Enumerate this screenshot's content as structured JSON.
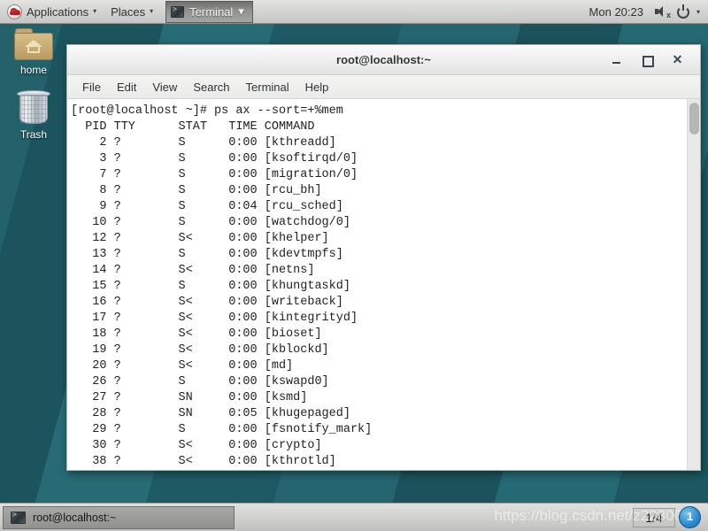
{
  "top_panel": {
    "menus": [
      {
        "label": "Applications",
        "icon": "redhat-logo",
        "caret": "▾"
      },
      {
        "label": "Places",
        "caret": "▾"
      }
    ],
    "window_button": {
      "label": "Terminal",
      "icon": "terminal-icon",
      "caret": "▾"
    },
    "clock": "Mon 20:23",
    "icons": [
      "speaker-muted-icon",
      "power-icon"
    ],
    "caret": "▾",
    "mute_mark": "x"
  },
  "desktop": {
    "icons": [
      {
        "label": "home",
        "icon": "folder-home-icon"
      },
      {
        "label": "Trash",
        "icon": "trash-icon"
      }
    ],
    "background_color": "#1f5c66"
  },
  "terminal": {
    "title": "root@localhost:~",
    "window_buttons": {
      "minimize": "–",
      "maximize": "□",
      "close": "✕"
    },
    "menubar": [
      "File",
      "Edit",
      "View",
      "Search",
      "Terminal",
      "Help"
    ],
    "prompt": "[root@localhost ~]#",
    "command": "ps ax --sort=+%mem",
    "columns": [
      "PID",
      "TTY",
      "STAT",
      "TIME",
      "COMMAND"
    ],
    "content": "[root@localhost ~]# ps ax --sort=+%mem\n  PID TTY      STAT   TIME COMMAND\n    2 ?        S      0:00 [kthreadd]\n    3 ?        S      0:00 [ksoftirqd/0]\n    7 ?        S      0:00 [migration/0]\n    8 ?        S      0:00 [rcu_bh]\n    9 ?        S      0:04 [rcu_sched]\n   10 ?        S      0:00 [watchdog/0]\n   12 ?        S<     0:00 [khelper]\n   13 ?        S      0:00 [kdevtmpfs]\n   14 ?        S<     0:00 [netns]\n   15 ?        S      0:00 [khungtaskd]\n   16 ?        S<     0:00 [writeback]\n   17 ?        S<     0:00 [kintegrityd]\n   18 ?        S<     0:00 [bioset]\n   19 ?        S<     0:00 [kblockd]\n   20 ?        S<     0:00 [md]\n   26 ?        S      0:00 [kswapd0]\n   27 ?        SN     0:00 [ksmd]\n   28 ?        SN     0:05 [khugepaged]\n   29 ?        S      0:00 [fsnotify_mark]\n   30 ?        S<     0:00 [crypto]\n   38 ?        S<     0:00 [kthrotld]",
    "rows": [
      {
        "pid": "2",
        "tty": "?",
        "stat": "S",
        "time": "0:00",
        "command": "[kthreadd]"
      },
      {
        "pid": "3",
        "tty": "?",
        "stat": "S",
        "time": "0:00",
        "command": "[ksoftirqd/0]"
      },
      {
        "pid": "7",
        "tty": "?",
        "stat": "S",
        "time": "0:00",
        "command": "[migration/0]"
      },
      {
        "pid": "8",
        "tty": "?",
        "stat": "S",
        "time": "0:00",
        "command": "[rcu_bh]"
      },
      {
        "pid": "9",
        "tty": "?",
        "stat": "S",
        "time": "0:04",
        "command": "[rcu_sched]"
      },
      {
        "pid": "10",
        "tty": "?",
        "stat": "S",
        "time": "0:00",
        "command": "[watchdog/0]"
      },
      {
        "pid": "12",
        "tty": "?",
        "stat": "S<",
        "time": "0:00",
        "command": "[khelper]"
      },
      {
        "pid": "13",
        "tty": "?",
        "stat": "S",
        "time": "0:00",
        "command": "[kdevtmpfs]"
      },
      {
        "pid": "14",
        "tty": "?",
        "stat": "S<",
        "time": "0:00",
        "command": "[netns]"
      },
      {
        "pid": "15",
        "tty": "?",
        "stat": "S",
        "time": "0:00",
        "command": "[khungtaskd]"
      },
      {
        "pid": "16",
        "tty": "?",
        "stat": "S<",
        "time": "0:00",
        "command": "[writeback]"
      },
      {
        "pid": "17",
        "tty": "?",
        "stat": "S<",
        "time": "0:00",
        "command": "[kintegrityd]"
      },
      {
        "pid": "18",
        "tty": "?",
        "stat": "S<",
        "time": "0:00",
        "command": "[bioset]"
      },
      {
        "pid": "19",
        "tty": "?",
        "stat": "S<",
        "time": "0:00",
        "command": "[kblockd]"
      },
      {
        "pid": "20",
        "tty": "?",
        "stat": "S<",
        "time": "0:00",
        "command": "[md]"
      },
      {
        "pid": "26",
        "tty": "?",
        "stat": "S",
        "time": "0:00",
        "command": "[kswapd0]"
      },
      {
        "pid": "27",
        "tty": "?",
        "stat": "SN",
        "time": "0:00",
        "command": "[ksmd]"
      },
      {
        "pid": "28",
        "tty": "?",
        "stat": "SN",
        "time": "0:05",
        "command": "[khugepaged]"
      },
      {
        "pid": "29",
        "tty": "?",
        "stat": "S",
        "time": "0:00",
        "command": "[fsnotify_mark]"
      },
      {
        "pid": "30",
        "tty": "?",
        "stat": "S<",
        "time": "0:00",
        "command": "[crypto]"
      },
      {
        "pid": "38",
        "tty": "?",
        "stat": "S<",
        "time": "0:00",
        "command": "[kthrotld]"
      }
    ]
  },
  "bottom_panel": {
    "taskbar_button": {
      "label": "root@localhost:~",
      "icon": "terminal-icon"
    },
    "workspace": "1/4",
    "watermark": "https://blog.csdn.net/z22806"
  }
}
